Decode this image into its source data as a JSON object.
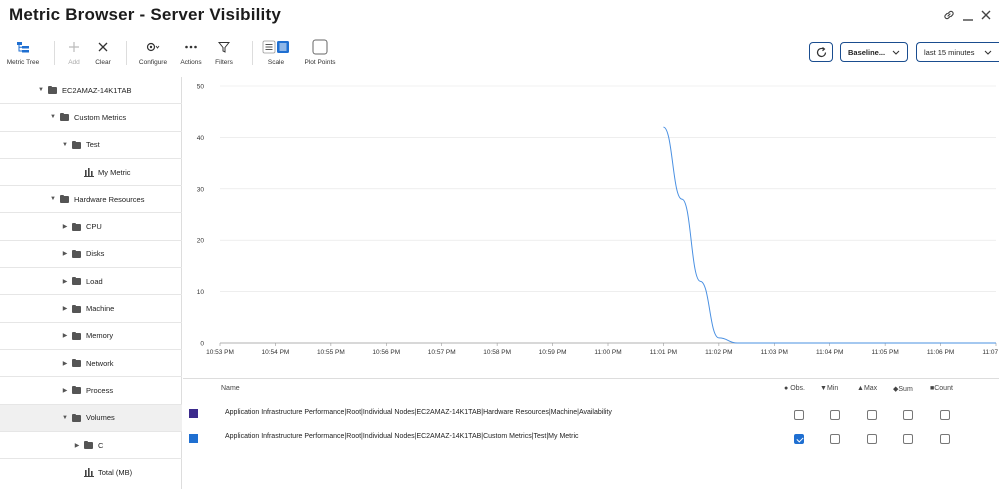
{
  "window": {
    "title": "Metric Browser - Server Visibility"
  },
  "toolbar": {
    "metric_tree": "Metric Tree",
    "add": "Add",
    "clear": "Clear",
    "configure": "Configure",
    "actions": "Actions",
    "filters": "Filters",
    "scale": "Scale",
    "plot_points": "Plot Points",
    "baseline": "Baseline...",
    "time_range": "last 15 minutes"
  },
  "tree": {
    "items": [
      {
        "label": "EC2AMAZ-14K1TAB",
        "type": "node",
        "expanded": true
      },
      {
        "label": "Custom Metrics",
        "type": "folder",
        "expanded": true
      },
      {
        "label": "Test",
        "type": "folder",
        "expanded": true
      },
      {
        "label": "My Metric",
        "type": "metric"
      },
      {
        "label": "Hardware Resources",
        "type": "folder",
        "expanded": true
      },
      {
        "label": "CPU",
        "type": "folder",
        "expanded": false
      },
      {
        "label": "Disks",
        "type": "folder",
        "expanded": false
      },
      {
        "label": "Load",
        "type": "folder",
        "expanded": false
      },
      {
        "label": "Machine",
        "type": "folder",
        "expanded": false
      },
      {
        "label": "Memory",
        "type": "folder",
        "expanded": false
      },
      {
        "label": "Network",
        "type": "folder",
        "expanded": false
      },
      {
        "label": "Process",
        "type": "folder",
        "expanded": false
      },
      {
        "label": "Volumes",
        "type": "folder",
        "expanded": true
      },
      {
        "label": "C",
        "type": "folder",
        "expanded": false
      },
      {
        "label": "Total (MB)",
        "type": "metric"
      }
    ]
  },
  "chart_data": {
    "type": "line",
    "x": [
      "10:53 PM",
      "10:54 PM",
      "10:55 PM",
      "10:56 PM",
      "10:57 PM",
      "10:58 PM",
      "10:59 PM",
      "11:00 PM",
      "11:01 PM",
      "11:02 PM",
      "11:03 PM",
      "11:04 PM",
      "11:05 PM",
      "11:06 PM",
      "11:07 PM"
    ],
    "yticks": [
      0,
      10,
      20,
      30,
      40,
      50
    ],
    "ylim": [
      0,
      50
    ],
    "grid": true,
    "series": [
      {
        "color": "#4a90e2",
        "points": [
          [
            "11:01 PM",
            42
          ],
          [
            "11:01:20 PM",
            28
          ],
          [
            "11:01:40 PM",
            12
          ],
          [
            "11:02 PM",
            1
          ],
          [
            "11:02:20 PM",
            0
          ],
          [
            "11:07 PM",
            0
          ]
        ]
      }
    ]
  },
  "legend": {
    "headers": {
      "name": "Name",
      "obs": "Obs.",
      "min": "Min",
      "max": "Max",
      "sum": "Sum",
      "count": "Count"
    },
    "rows": [
      {
        "color": "#3b2a8c",
        "name": "Application Infrastructure Performance|Root|Individual Nodes|EC2AMAZ-14K1TAB|Hardware Resources|Machine|Availability",
        "obs": false,
        "min": false,
        "max": false,
        "sum": false,
        "count": false
      },
      {
        "color": "#1f6fd1",
        "name": "Application Infrastructure Performance|Root|Individual Nodes|EC2AMAZ-14K1TAB|Custom Metrics|Test|My Metric",
        "obs": true,
        "min": false,
        "max": false,
        "sum": false,
        "count": false
      }
    ]
  }
}
